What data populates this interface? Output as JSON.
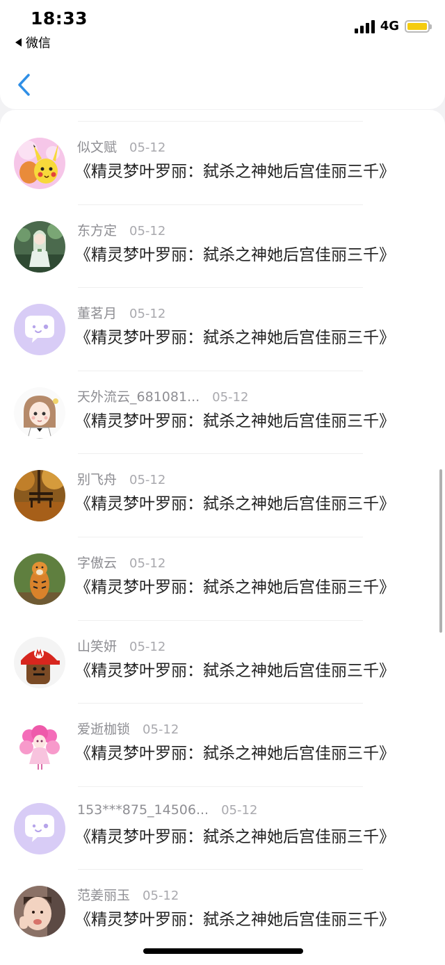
{
  "status_bar": {
    "time": "18:33",
    "back_app_label": "微信",
    "network": "4G",
    "battery_color": "#f5cc0f"
  },
  "header": {
    "back_icon": "chevron-left-icon",
    "accent_color": "#2f8fe6"
  },
  "list": {
    "items": [
      {
        "name": "似文赋",
        "date": "05-12",
        "message": "《精灵梦叶罗丽：弑杀之神她后宫佳丽三千》",
        "avatar": "pikachu"
      },
      {
        "name": "东方定",
        "date": "05-12",
        "message": "《精灵梦叶罗丽：弑杀之神她后宫佳丽三千》",
        "avatar": "anime-fairy"
      },
      {
        "name": "董茗月",
        "date": "05-12",
        "message": "《精灵梦叶罗丽：弑杀之神她后宫佳丽三千》",
        "avatar": "default-chat"
      },
      {
        "name": "天外流云_681081...",
        "date": "05-12",
        "message": "《精灵梦叶罗丽：弑杀之神她后宫佳丽三千》",
        "avatar": "sketch-girl"
      },
      {
        "name": "别飞舟",
        "date": "05-12",
        "message": "《精灵梦叶罗丽：弑杀之神她后宫佳丽三千》",
        "avatar": "autumn-bench"
      },
      {
        "name": "字傲云",
        "date": "05-12",
        "message": "《精灵梦叶罗丽：弑杀之神她后宫佳丽三千》",
        "avatar": "tiger"
      },
      {
        "name": "山笑妍",
        "date": "05-12",
        "message": "《精灵梦叶罗丽：弑杀之神她后宫佳丽三千》",
        "avatar": "mario-cap"
      },
      {
        "name": "爱逝枷锁",
        "date": "05-12",
        "message": "《精灵梦叶罗丽：弑杀之神她后宫佳丽三千》",
        "avatar": "pink-doll"
      },
      {
        "name": "153***875_14506...",
        "date": "05-12",
        "message": "《精灵梦叶罗丽：弑杀之神她后宫佳丽三千》",
        "avatar": "default-chat"
      },
      {
        "name": "范姜丽玉",
        "date": "05-12",
        "message": "《精灵梦叶罗丽：弑杀之神她后宫佳丽三千》",
        "avatar": "child-photo"
      }
    ]
  }
}
